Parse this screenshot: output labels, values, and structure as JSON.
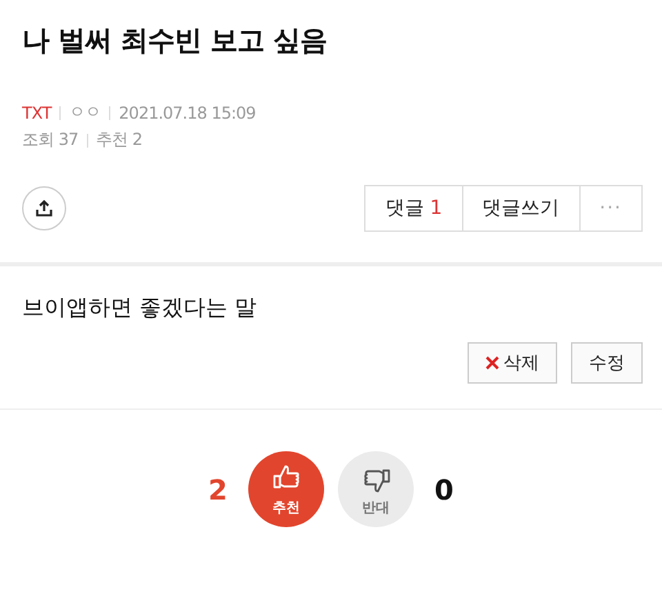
{
  "title": "나 벌써 최수빈 보고 싶음",
  "meta": {
    "board": "TXT",
    "author": "ㅇㅇ",
    "datetime": "2021.07.18 15:09",
    "views": "조회 37",
    "recommends": "추천 2"
  },
  "comment_bar": {
    "comments_label": "댓글",
    "comments_count": "1",
    "write_label": "댓글쓰기",
    "more": "···"
  },
  "body": "브이앱하면 좋겠다는 말",
  "post_actions": [
    {
      "kind": "delete",
      "label": "삭제"
    },
    {
      "kind": "edit",
      "label": "수정"
    }
  ],
  "votes": [
    {
      "kind": "up",
      "count": "2",
      "label": "추천"
    },
    {
      "kind": "down",
      "count": "0",
      "label": "반대"
    }
  ]
}
